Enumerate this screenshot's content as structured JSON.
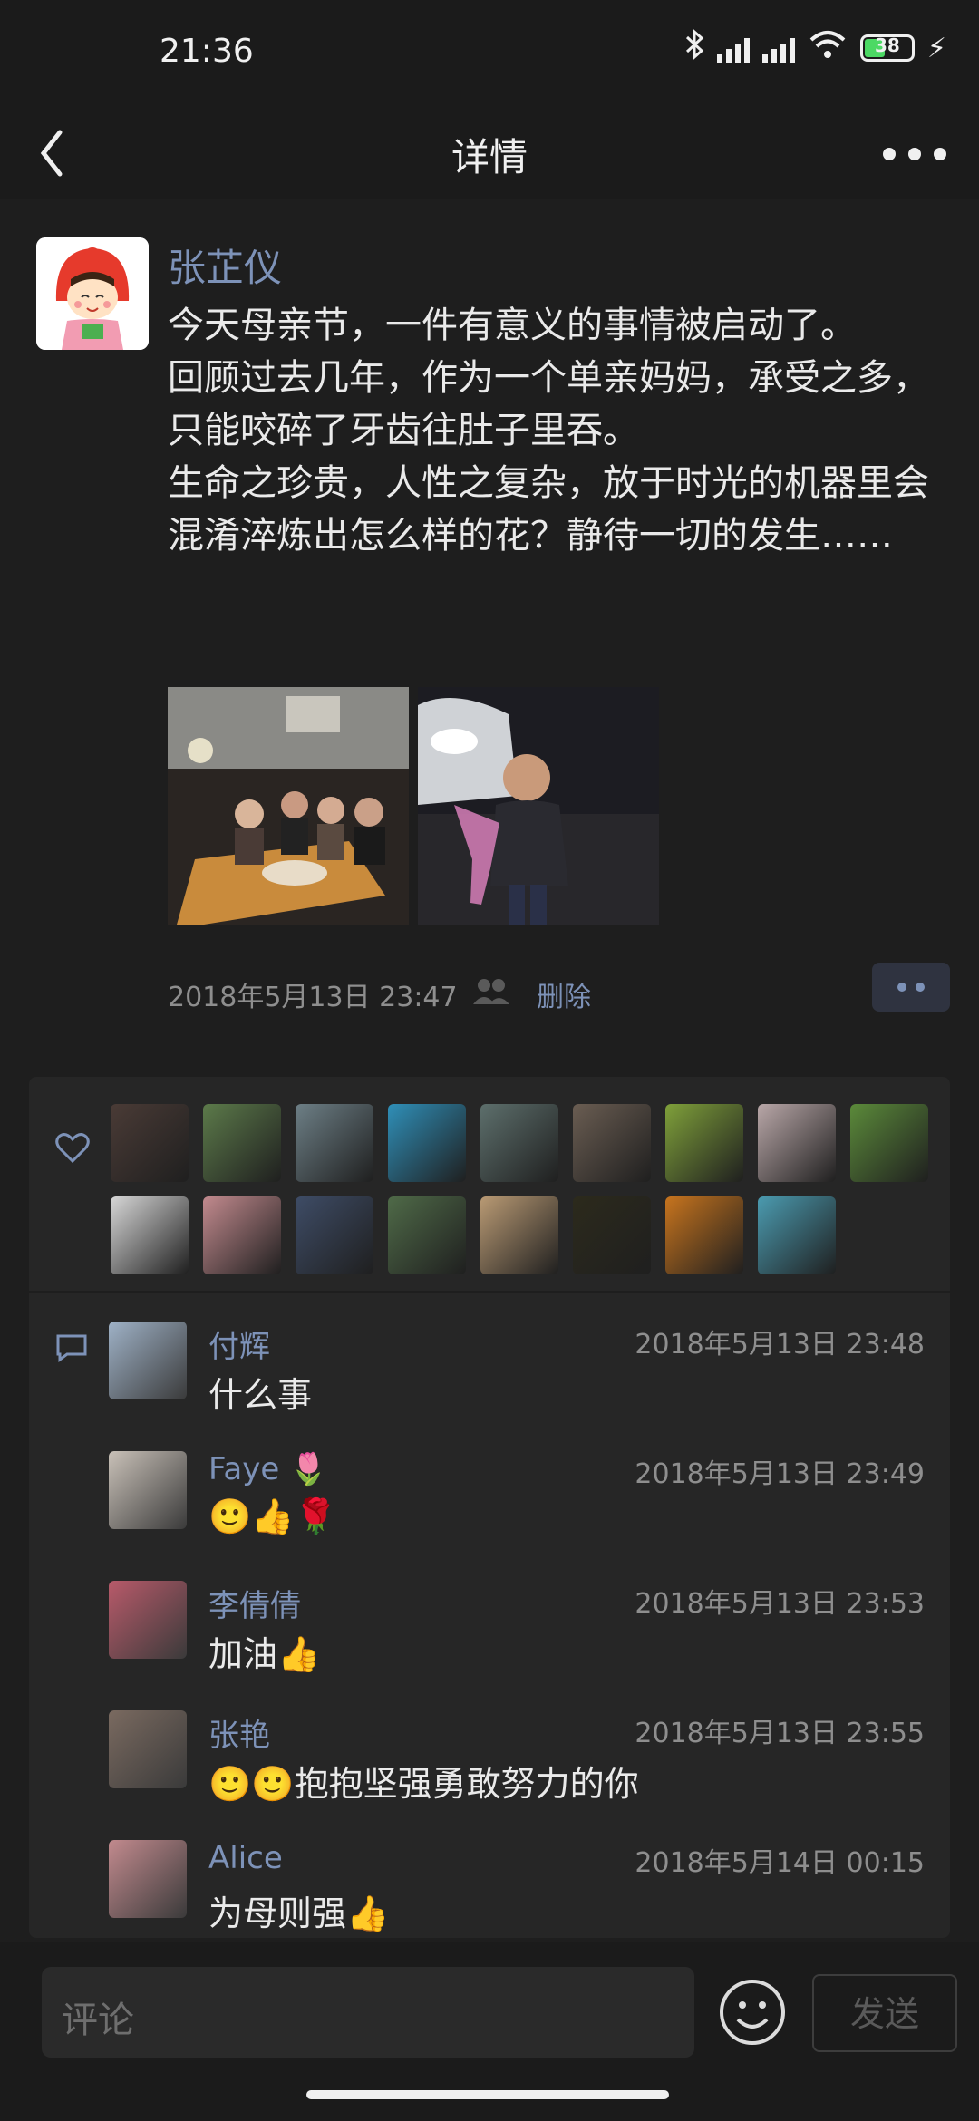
{
  "status_bar": {
    "time": "21:36",
    "battery": "38"
  },
  "header": {
    "title": "详情"
  },
  "post": {
    "author": "张芷仪",
    "text": "今天母亲节，一件有意义的事情被启动了。\n回顾过去几年，作为一个单亲妈妈，承受之多，只能咬碎了牙齿往肚子里吞。\n生命之珍贵，人性之复杂，放于时光的机器里会混淆淬炼出怎么样的花？静待一切的发生……",
    "timestamp": "2018年5月13日 23:47",
    "delete_label": "删除"
  },
  "likes_colors": [
    "#4a3b36",
    "#5c7a4a",
    "#6d7f86",
    "#2f8fb8",
    "#5d6f6c",
    "#6a5d52",
    "#7fa03a",
    "#b9a7a8",
    "#5b8a3a",
    "#d7d7d7",
    "#c28a8e",
    "#3e4c66",
    "#4f6a48",
    "#b99a74",
    "#2c2a1c",
    "#c7741e",
    "#4b9bb0"
  ],
  "comments": [
    {
      "name": "付辉",
      "time": "2018年5月13日 23:48",
      "text": "什么事",
      "avatar_color": "#9fb2c7"
    },
    {
      "name": "Faye 🌷",
      "time": "2018年5月13日 23:49",
      "text": "🙂👍🌹",
      "avatar_color": "#c9c1b8"
    },
    {
      "name": "李倩倩",
      "time": "2018年5月13日 23:53",
      "text": "加油👍",
      "avatar_color": "#b85a6a"
    },
    {
      "name": "张艳",
      "time": "2018年5月13日 23:55",
      "text": "🙂🙂抱抱坚强勇敢努力的你",
      "avatar_color": "#7a6a60"
    },
    {
      "name": "Alice",
      "time": "2018年5月14日 00:15",
      "text": "为母则强👍",
      "avatar_color": "#c28a8e"
    }
  ],
  "input": {
    "placeholder": "评论"
  },
  "send_label": "发送"
}
